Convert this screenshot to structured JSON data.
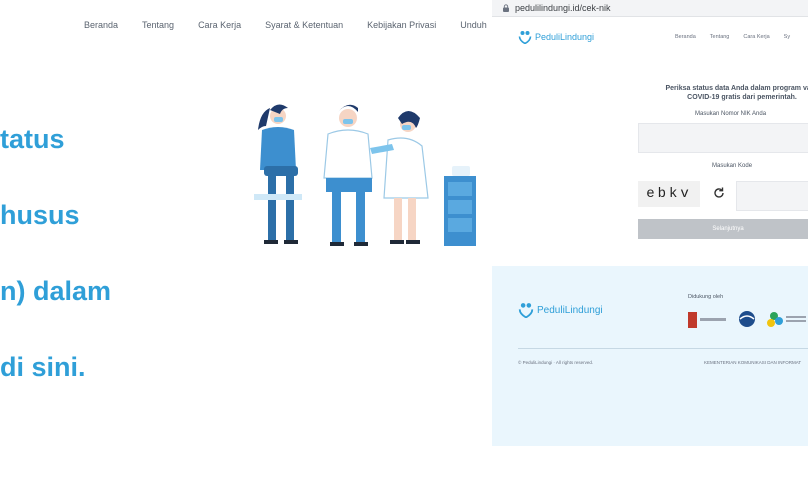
{
  "left_page": {
    "nav": [
      "Beranda",
      "Tentang",
      "Cara Kerja",
      "Syarat & Ketentuan",
      "Kebijakan Privasi",
      "Unduh"
    ],
    "hero_lines": [
      "tatus",
      "husus",
      "n) dalam",
      "di sini."
    ]
  },
  "browser": {
    "url": "pedulilindungi.id/cek-nik"
  },
  "site": {
    "logo_text": "PeduliLindungi",
    "nav": [
      "Beranda",
      "Tentang",
      "Cara Kerja",
      "Sy"
    ],
    "form": {
      "title_line1": "Periksa status data Anda dalam program vaks",
      "title_line2": "COVID-19 gratis dari pemerintah.",
      "nik_label": "Masukan Nomor NIK Anda",
      "nik_value": "",
      "code_label": "Masukan Kode",
      "captcha_text": "ebkv",
      "code_value": "",
      "submit_label": "Selanjutnya"
    },
    "footer": {
      "logo_text": "PeduliLindungi",
      "supported_by": "Didukung oleh",
      "copyright": "© PeduliLindungi · All rights reserved.",
      "ministry": "KEMENTERIAN KOMUNIKASI DAN INFORMAT"
    }
  },
  "colors": {
    "accent": "#2f9fd8",
    "footer_bg": "#eaf6fd",
    "button_disabled": "#bfc3c8"
  }
}
